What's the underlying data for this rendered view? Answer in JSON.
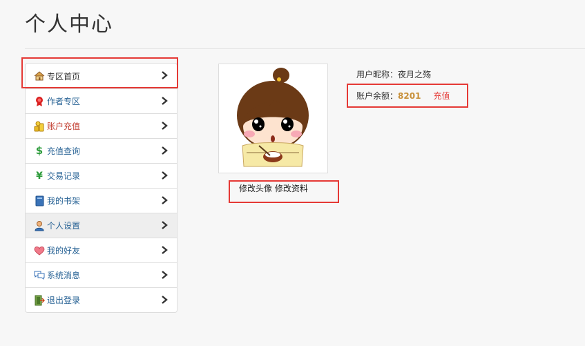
{
  "page": {
    "title": "个人中心"
  },
  "menu": {
    "items": [
      {
        "label": "专区首页",
        "icon": "home-icon"
      },
      {
        "label": "作者专区",
        "icon": "ribbon-icon"
      },
      {
        "label": "账户充值",
        "icon": "coins-icon"
      },
      {
        "label": "充值查询",
        "icon": "dollar-icon"
      },
      {
        "label": "交易记录",
        "icon": "yen-icon"
      },
      {
        "label": "我的书架",
        "icon": "book-icon"
      },
      {
        "label": "个人设置",
        "icon": "user-icon"
      },
      {
        "label": "我的好友",
        "icon": "heart-icon"
      },
      {
        "label": "系统消息",
        "icon": "chat-bubbles-icon"
      },
      {
        "label": "退出登录",
        "icon": "exit-icon"
      }
    ],
    "active": "个人设置"
  },
  "profile": {
    "edit_avatar": "修改头像",
    "edit_profile": "修改资料",
    "nickname_label": "用户昵称：",
    "nickname": "夜月之殇",
    "balance_label": "账户余额：",
    "balance": "8201",
    "recharge": "充值"
  },
  "colors": {
    "link": "#2a6496",
    "highlight": "#e53935",
    "balance": "#c8903a"
  }
}
